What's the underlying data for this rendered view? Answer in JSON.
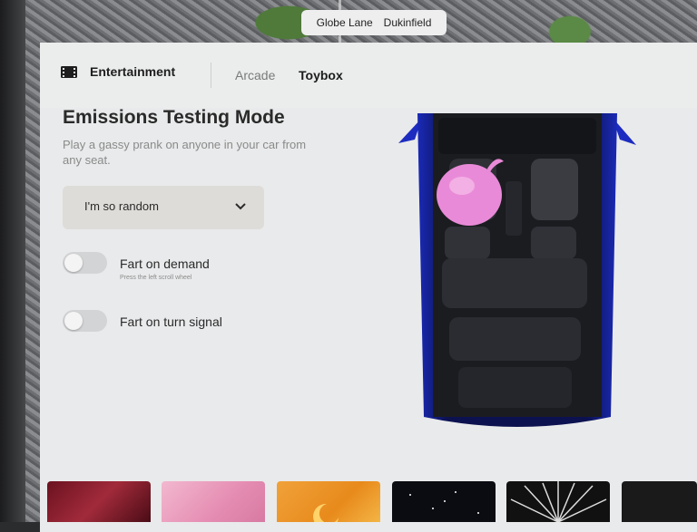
{
  "location": {
    "street": "Globe Lane",
    "town": "Dukinfield"
  },
  "header": {
    "section_title": "Entertainment",
    "section_icon": "film-clapper-icon",
    "tabs": [
      {
        "label": "Arcade",
        "active": false
      },
      {
        "label": "Toybox",
        "active": true
      }
    ]
  },
  "mode": {
    "title": "Emissions Testing Mode",
    "description": "Play a gassy prank on anyone in your car from any seat."
  },
  "sound_select": {
    "selected": "I'm so random",
    "icon": "chevron-down-icon"
  },
  "toggles": [
    {
      "label": "Fart on demand",
      "hint": "Press the left scroll wheel",
      "on": false
    },
    {
      "label": "Fart on turn signal",
      "on": false
    }
  ],
  "car_view": {
    "seat_marker_icon": "pink-cushion-icon",
    "marker_color": "#e98ad8",
    "car_color": "#1a2a9a"
  },
  "thumbnails": [
    {
      "icon": "red-ornament-thumbnail"
    },
    {
      "icon": "pink-bubble-thumbnail"
    },
    {
      "icon": "orange-moon-thumbnail"
    },
    {
      "icon": "starfield-thumbnail"
    },
    {
      "icon": "lightspeed-thumbnail"
    },
    {
      "icon": "dark-thumbnail"
    }
  ]
}
